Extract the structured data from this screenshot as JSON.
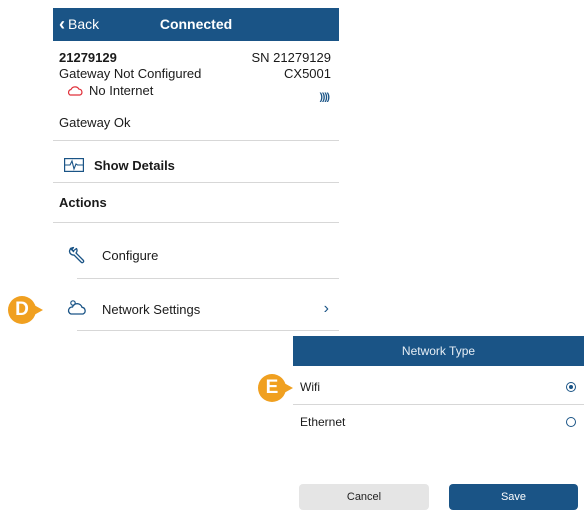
{
  "navbar": {
    "back_label": "Back",
    "title": "Connected"
  },
  "device": {
    "id": "21279129",
    "serial": "SN 21279129",
    "status": "Gateway Not Configured",
    "model": "CX5001",
    "internet": "No Internet",
    "signal": "))))",
    "gateway_status": "Gateway Ok"
  },
  "details": {
    "label": "Show Details"
  },
  "actions": {
    "heading": "Actions",
    "items": [
      {
        "label": "Configure",
        "icon": "wrench-icon"
      },
      {
        "label": "Network Settings",
        "icon": "cloud-settings-icon"
      }
    ]
  },
  "markers": {
    "d": "D",
    "e": "E"
  },
  "network_type": {
    "title": "Network Type",
    "options": [
      {
        "label": "Wifi",
        "selected": true
      },
      {
        "label": "Ethernet",
        "selected": false
      }
    ],
    "cancel_label": "Cancel",
    "save_label": "Save"
  },
  "colors": {
    "primary": "#1a5486",
    "marker": "#f0a020",
    "alert": "#e0303a"
  }
}
